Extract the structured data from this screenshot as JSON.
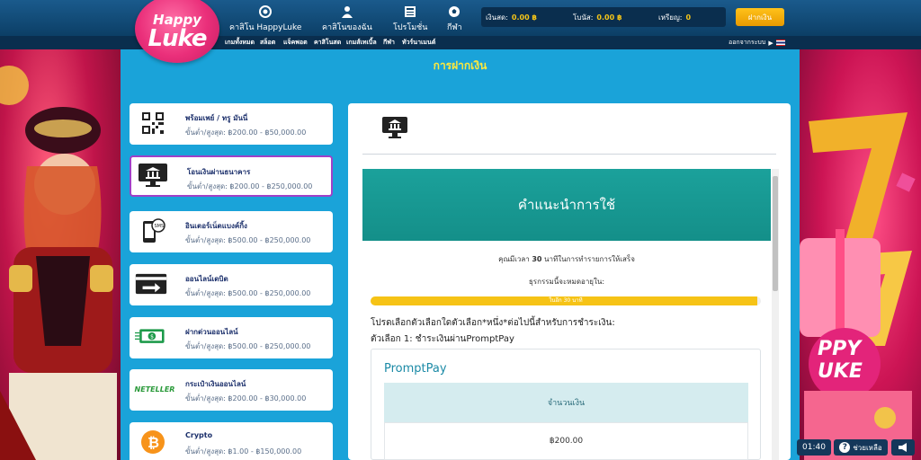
{
  "brand": {
    "logo_top": "Happy",
    "logo_bottom": "Luke"
  },
  "nav": [
    {
      "label": "คาสิโน HappyLuke",
      "icon": "poker-chip-icon"
    },
    {
      "label": "คาสิโนของฉัน",
      "icon": "user-icon"
    },
    {
      "label": "โปรโมชั่น",
      "icon": "newspaper-icon"
    },
    {
      "label": "กีฬา",
      "icon": "soccer-ball-icon"
    }
  ],
  "balances": {
    "cash_label": "เงินสด:",
    "cash_value": "0.00 ฿",
    "bonus_label": "โบนัส:",
    "bonus_value": "0.00 ฿",
    "coins_label": "เหรียญ:",
    "coins_value": "0"
  },
  "deposit_button": "ฝากเงิน",
  "subnav": [
    "เกมทั้งหมด",
    "สล็อต",
    "แจ็คพอต",
    "คาสิโนสด",
    "เกมส์เทเบิ้ล",
    "กีฬา",
    "ทัวร์นาเมนต์"
  ],
  "logout": "ออกจากระบบ",
  "page_title": "การฝากเงิน",
  "methods": [
    {
      "name": "พร้อมเพย์ / ทรู มันนี่",
      "limits": "ขั้นต่ำ/สูงสุด: ฿200.00 - ฿50,000.00",
      "icon": "qr-code-icon"
    },
    {
      "name": "โอนเงินผ่านธนาคาร",
      "limits": "ขั้นต่ำ/สูงสุด: ฿200.00 - ฿250,000.00",
      "icon": "bank-monitor-icon",
      "selected": true
    },
    {
      "name": "อินเตอร์เน็ตแบงค์กิ้ง",
      "limits": "ขั้นต่ำ/สูงสุด: ฿500.00 - ฿250,000.00",
      "icon": "phone-sms-icon"
    },
    {
      "name": "ออนไลน์เดบิต",
      "limits": "ขั้นต่ำ/สูงสุด: ฿500.00 - ฿250,000.00",
      "icon": "card-arrow-icon"
    },
    {
      "name": "ฝากด่วนออนไลน์",
      "limits": "ขั้นต่ำ/สูงสุด: ฿500.00 - ฿250,000.00",
      "icon": "cash-icon"
    },
    {
      "name": "กระเป๋าเงินออนไลน์",
      "limits": "ขั้นต่ำ/สูงสุด: ฿200.00 - ฿30,000.00",
      "icon": "neteller-logo",
      "logo_text": "NETELLER"
    },
    {
      "name": "Crypto",
      "limits": "ขั้นต่ำ/สูงสุด: ฿1.00 - ฿150,000.00",
      "icon": "bitcoin-icon"
    }
  ],
  "detail": {
    "instructions_title": "คำแนะนำการใช้",
    "time_note_pre": "คุณมีเวลา ",
    "time_note_bold": "30",
    "time_note_post": " นาทีในการทำรายการให้เสร็จ",
    "expires_note": "ธุรกรรมนี้จะหมดอายุใน:",
    "progress_label": "ในอีก 30 นาที",
    "progress_fraction": 0.99,
    "choose_text": "โปรดเลือกตัวเลือกใดตัวเลือก*หนึ่ง*ต่อไปนี้สำหรับการชำระเงิน:",
    "option_text": "ตัวเลือก 1: ชำระเงินผ่านPromptPay",
    "option_title": "PromptPay",
    "amount_header": "จำนวนเงิน",
    "amount_value": "฿200.00"
  },
  "widgets": {
    "time": "01:40",
    "help": "ช่วยเหลือ"
  },
  "colors": {
    "accent": "#1aa3d9",
    "highlight": "#ffe93d",
    "teal": "#1ba19b",
    "selected_border": "#a040c8"
  }
}
